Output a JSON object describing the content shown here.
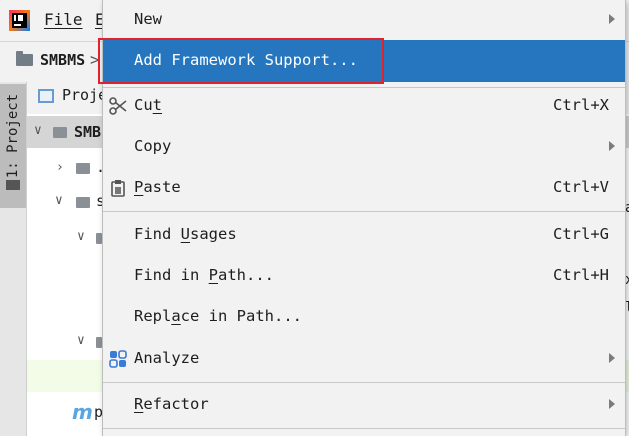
{
  "menubar": {
    "file_label": "File",
    "edit_partial": "E"
  },
  "navbar": {
    "project_name": "SMBMS",
    "separator": ">"
  },
  "sidebar": {
    "tab_label": "1: Project"
  },
  "project_tree": {
    "header_label": "Proje",
    "root_label": "SMB",
    "row_a_label": ".",
    "row_b_label": "s",
    "pom_label": "p"
  },
  "right_edge_text": {
    "a": "a",
    "x": "x",
    "l": "l"
  },
  "context_menu": {
    "items": [
      {
        "label": "New",
        "mnemonic": "",
        "shortcut": "",
        "submenu": true,
        "icon": ""
      },
      {
        "label": "Add Framework Support...",
        "shortcut": "",
        "submenu": false,
        "icon": "",
        "selected": true
      },
      {
        "label_pre": "Cu",
        "mnemonic": "t",
        "label_post": "",
        "shortcut": "Ctrl+X",
        "icon": "scissors-icon"
      },
      {
        "label": "Copy",
        "shortcut": "",
        "submenu": true,
        "icon": ""
      },
      {
        "label_pre": "",
        "mnemonic": "P",
        "label_post": "aste",
        "shortcut": "Ctrl+V",
        "icon": "clipboard-icon"
      },
      {
        "label_pre": "Find ",
        "mnemonic": "U",
        "label_post": "sages",
        "shortcut": "Ctrl+G",
        "icon": ""
      },
      {
        "label_pre": "Find in ",
        "mnemonic": "P",
        "label_post": "ath...",
        "shortcut": "Ctrl+H",
        "icon": ""
      },
      {
        "label_pre": "Repl",
        "mnemonic": "a",
        "label_post": "ce in Path...",
        "shortcut": "",
        "icon": ""
      },
      {
        "label": "Analyze",
        "shortcut": "",
        "submenu": true,
        "icon": "analyze-icon"
      },
      {
        "label_pre": "",
        "mnemonic": "R",
        "label_post": "efactor",
        "shortcut": "",
        "submenu": true,
        "icon": ""
      }
    ]
  },
  "colors": {
    "selection_bg": "#2675bf",
    "annotation_box": "#e0212e",
    "menu_bg": "#f2f2f2"
  }
}
